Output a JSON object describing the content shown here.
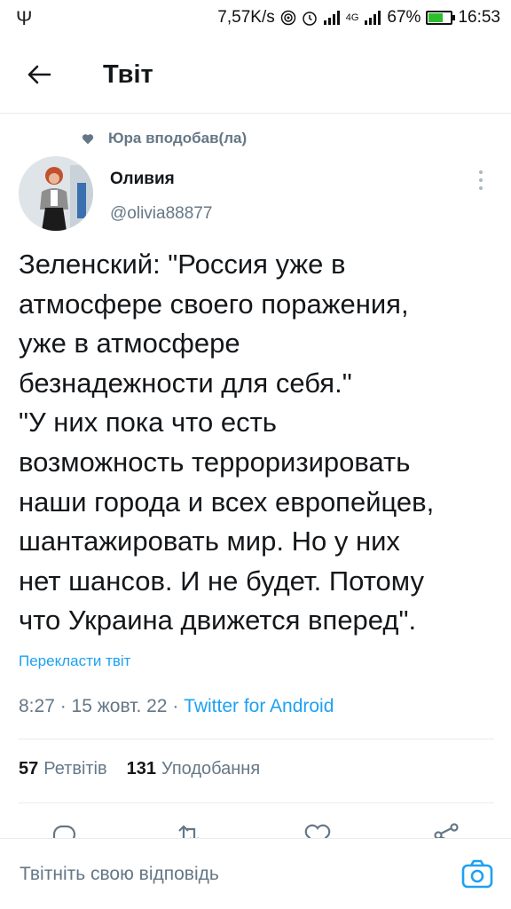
{
  "status_bar": {
    "usb_icon": "usb-icon",
    "network_speed": "7,57K/s",
    "network_type": "4G",
    "battery_percent": "67%",
    "battery_level": 0.67,
    "time": "16:53"
  },
  "header": {
    "back_icon": "arrow-left-icon",
    "title": "Твіт"
  },
  "social_context": {
    "icon": "heart-icon",
    "text": "Юра вподобав(ла)"
  },
  "author": {
    "name": "Оливия",
    "handle": "@olivia88877",
    "more_icon": "more-vertical-icon"
  },
  "tweet": {
    "lines": [
      "Зеленский: \"Россия уже в",
      "атмосфере своего поражения,",
      "уже в атмосфере",
      "безнадежности для себя.\"",
      "\"У них пока что есть",
      "возможность терроризировать",
      "наши города и всех европейцев,",
      "шантажировать мир. Но у них",
      "нет шансов. И не будет. Потому",
      "что Украина движется вперед\"."
    ],
    "translate_label": "Перекласти твіт",
    "time": "8:27",
    "date": "15 жовт. 22",
    "source": "Twitter for Android"
  },
  "stats": {
    "retweets_count": "57",
    "retweets_label": "Ретвітів",
    "likes_count": "131",
    "likes_label": "Уподобання"
  },
  "actions": [
    "reply-icon",
    "retweet-icon",
    "like-icon",
    "share-icon"
  ],
  "reply_bar": {
    "placeholder": "Твітніть свою відповідь",
    "camera_icon": "camera-icon"
  },
  "colors": {
    "accent": "#1da1f2",
    "secondary_text": "#657786",
    "primary_text": "#14171a",
    "battery": "#2cbe2c"
  }
}
